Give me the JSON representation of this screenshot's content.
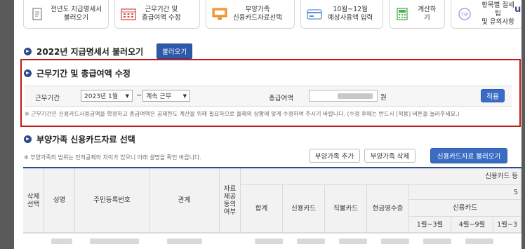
{
  "steps": [
    {
      "label": "전년도 지급명세서\n불러오기",
      "icon": "document-icon"
    },
    {
      "label": "근무기간 및\n총급여액 수정",
      "icon": "calendar-icon"
    },
    {
      "label": "부양가족\n신용카드자료선택",
      "icon": "monitor-icon"
    },
    {
      "label": "10월~12월\n예상사용액 입력",
      "icon": "card-icon"
    },
    {
      "label": "계산하기",
      "icon": "calculator-icon"
    },
    {
      "label": "항목별 절세 팁\n및 유의사항",
      "icon": "tip-icon"
    }
  ],
  "edge_text": "u",
  "section1": {
    "title": "2022년 지급명세서 불러오기",
    "button": "불러오기"
  },
  "section2": {
    "title": "근무기간 및 총급여액 수정",
    "period_label": "근무기간",
    "start_select": "2023년 1월",
    "tilde": "~",
    "end_select": "계속 근무",
    "amount_label": "총급여액",
    "unit": "원",
    "apply_button": "적용",
    "note": "※ 근무기간은 신용카드사용금액을 확정하고 총급여액은 공제한도 계산을 위해 필요하므로 올해의 상황에 맞게 수정하여 주시기 바랍니다. (수정 후에는 반드시 [적용] 버튼을 눌러주세요.)"
  },
  "section3": {
    "title": "부양가족 신용카드자료 선택",
    "note": "※ 부양가족의 범위는 인적공제와 차이가 있으니 아래 설명을 확인 바랍니다.",
    "add_button": "부양가족 추가",
    "delete_button": "부양가족 삭제",
    "load_button": "신용카드자료 불러오기"
  },
  "table": {
    "headers": {
      "select": "삭제\n선택",
      "name": "성명",
      "id": "주민등록번호",
      "relation": "관계",
      "consent": "자료\n제공\n동의\n여부",
      "group_top": "신용카드 등",
      "group_mid": "5",
      "total": "합계",
      "credit": "신용카드",
      "debit": "직불카드",
      "cash": "현금영수증",
      "credit_sub": "신용카드",
      "p1": "1월~3월",
      "p2": "4월~9월",
      "p3": "1월~3"
    }
  }
}
